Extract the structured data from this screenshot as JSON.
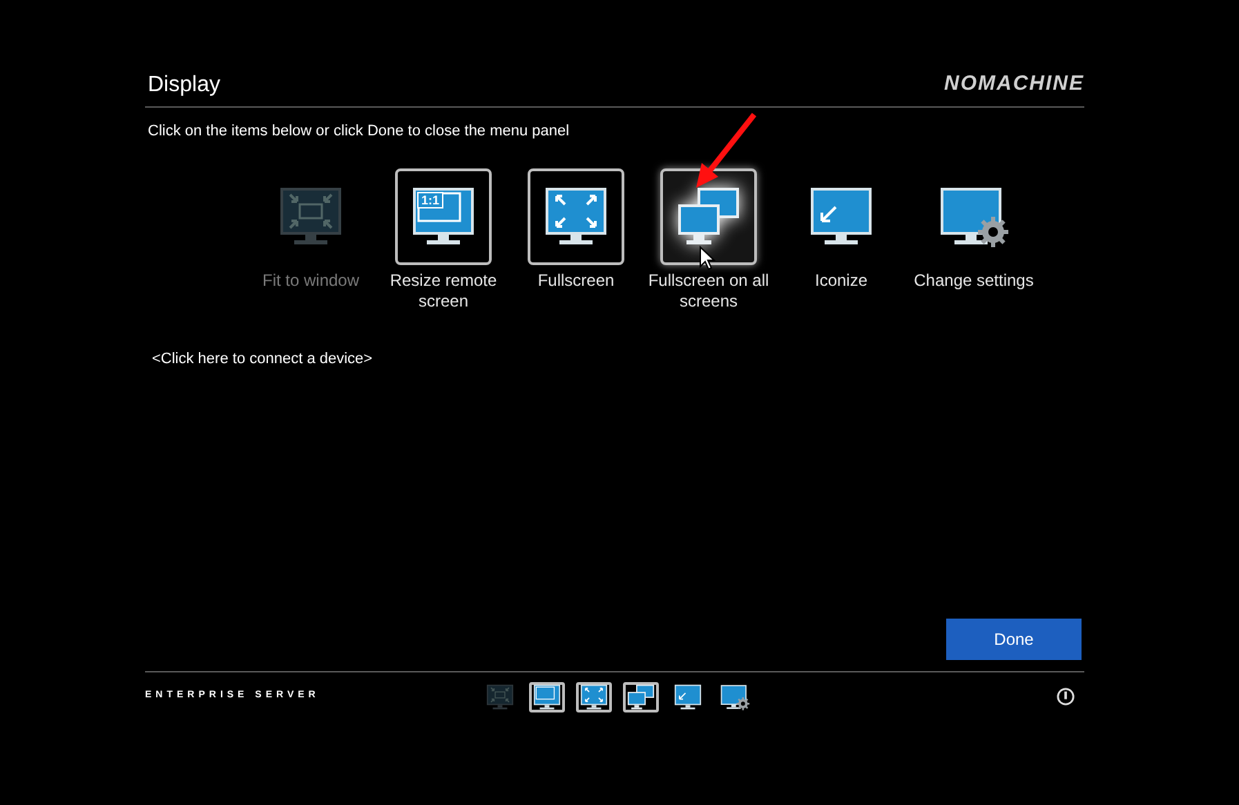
{
  "header": {
    "title": "Display",
    "logo": "NOMACHINE"
  },
  "instruction": "Click on the items below or click Done to close the menu panel",
  "items": [
    {
      "label": "Fit to window",
      "kind": "action",
      "disabled": true,
      "selected": false
    },
    {
      "label": "Resize remote screen",
      "kind": "toggle",
      "disabled": false,
      "selected": false,
      "icon_text": "1:1"
    },
    {
      "label": "Fullscreen",
      "kind": "toggle",
      "disabled": false,
      "selected": false
    },
    {
      "label": "Fullscreen on all screens",
      "kind": "toggle",
      "disabled": false,
      "selected": true
    },
    {
      "label": "Iconize",
      "kind": "action",
      "disabled": false,
      "selected": false
    },
    {
      "label": "Change settings",
      "kind": "action",
      "disabled": false,
      "selected": false
    }
  ],
  "device_link": "<Click here to connect a device>",
  "done_button": "Done",
  "footer": {
    "edition": "ENTERPRISE SERVER"
  }
}
